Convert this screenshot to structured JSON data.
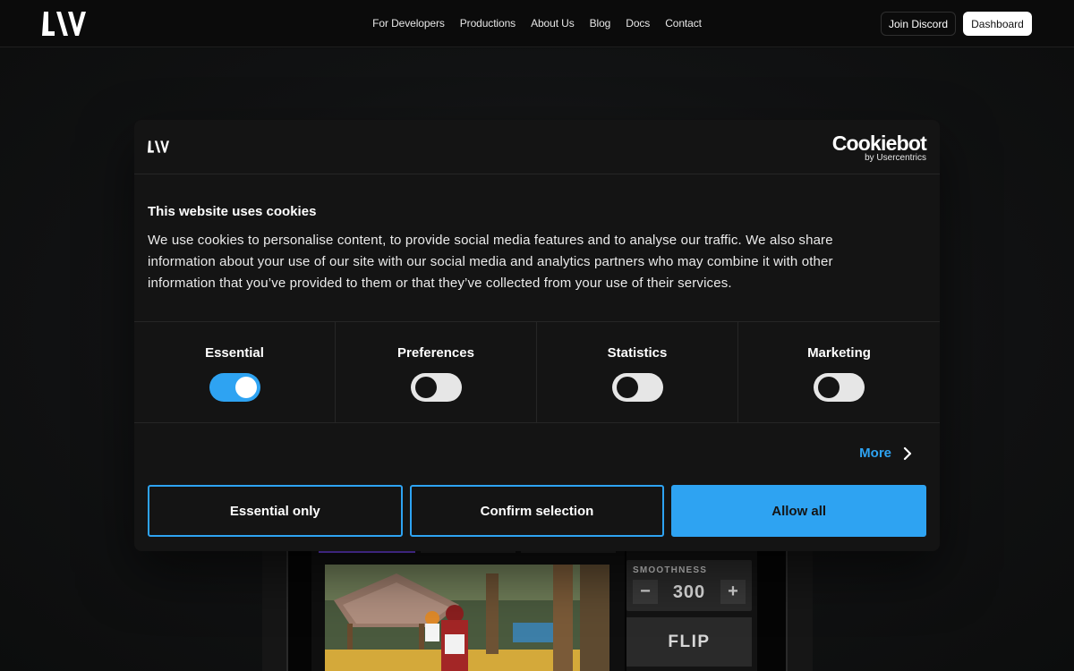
{
  "nav": {
    "logo_icon": "liv-logo-icon",
    "links": [
      "For Developers",
      "Productions",
      "About Us",
      "Blog",
      "Docs",
      "Contact"
    ],
    "join_discord": "Join Discord",
    "dashboard": "Dashboard"
  },
  "background": {
    "smoothness_label": "SMOOTHNESS",
    "smoothness_minus": "−",
    "smoothness_value": "300",
    "smoothness_plus": "+",
    "flip_label": "FLIP"
  },
  "cookie": {
    "brand": "Cookiebot",
    "brand_sub": "by Usercentrics",
    "title": "This website uses cookies",
    "body": "We use cookies to personalise content, to provide social media features and to analyse our traffic. We also share information about your use of our site with our social media and analytics partners who may combine it with other information that you’ve provided to them or that they’ve collected from your use of their services.",
    "categories": [
      {
        "label": "Essential",
        "enabled": true
      },
      {
        "label": "Preferences",
        "enabled": false
      },
      {
        "label": "Statistics",
        "enabled": false
      },
      {
        "label": "Marketing",
        "enabled": false
      }
    ],
    "more": "More",
    "buttons": {
      "essential_only": "Essential only",
      "confirm_selection": "Confirm selection",
      "allow_all": "Allow all"
    }
  },
  "colors": {
    "accent": "#2ea3f2",
    "dialog_bg": "#141414",
    "page_bg": "#0d0e0e"
  }
}
